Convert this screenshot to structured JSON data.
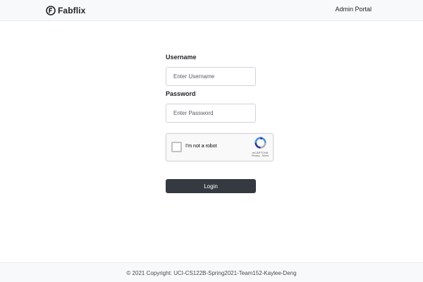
{
  "navbar": {
    "brand_name": "Fabflix",
    "brand_icon": "fabflix-logo-icon",
    "link_label": "Admin Portal"
  },
  "login_form": {
    "username_label": "Username",
    "username_placeholder": "Enter Username",
    "username_value": "",
    "password_label": "Password",
    "password_placeholder": "Enter Password",
    "password_value": "",
    "submit_label": "Login"
  },
  "recaptcha": {
    "checkbox_label": "I'm not a robot",
    "checked": false,
    "brand": "reCAPTCHA",
    "links": "Privacy - Terms",
    "logo_icon": "recaptcha-logo-icon"
  },
  "footer": {
    "copyright": "© 2021 Copyright: UCI-CS122B-Spring2021-Team152-Kaylee-Deng"
  },
  "colors": {
    "navbar_bg": "#f8f9fa",
    "button_bg": "#343a40",
    "recaptcha_blue": "#4a90e2"
  }
}
